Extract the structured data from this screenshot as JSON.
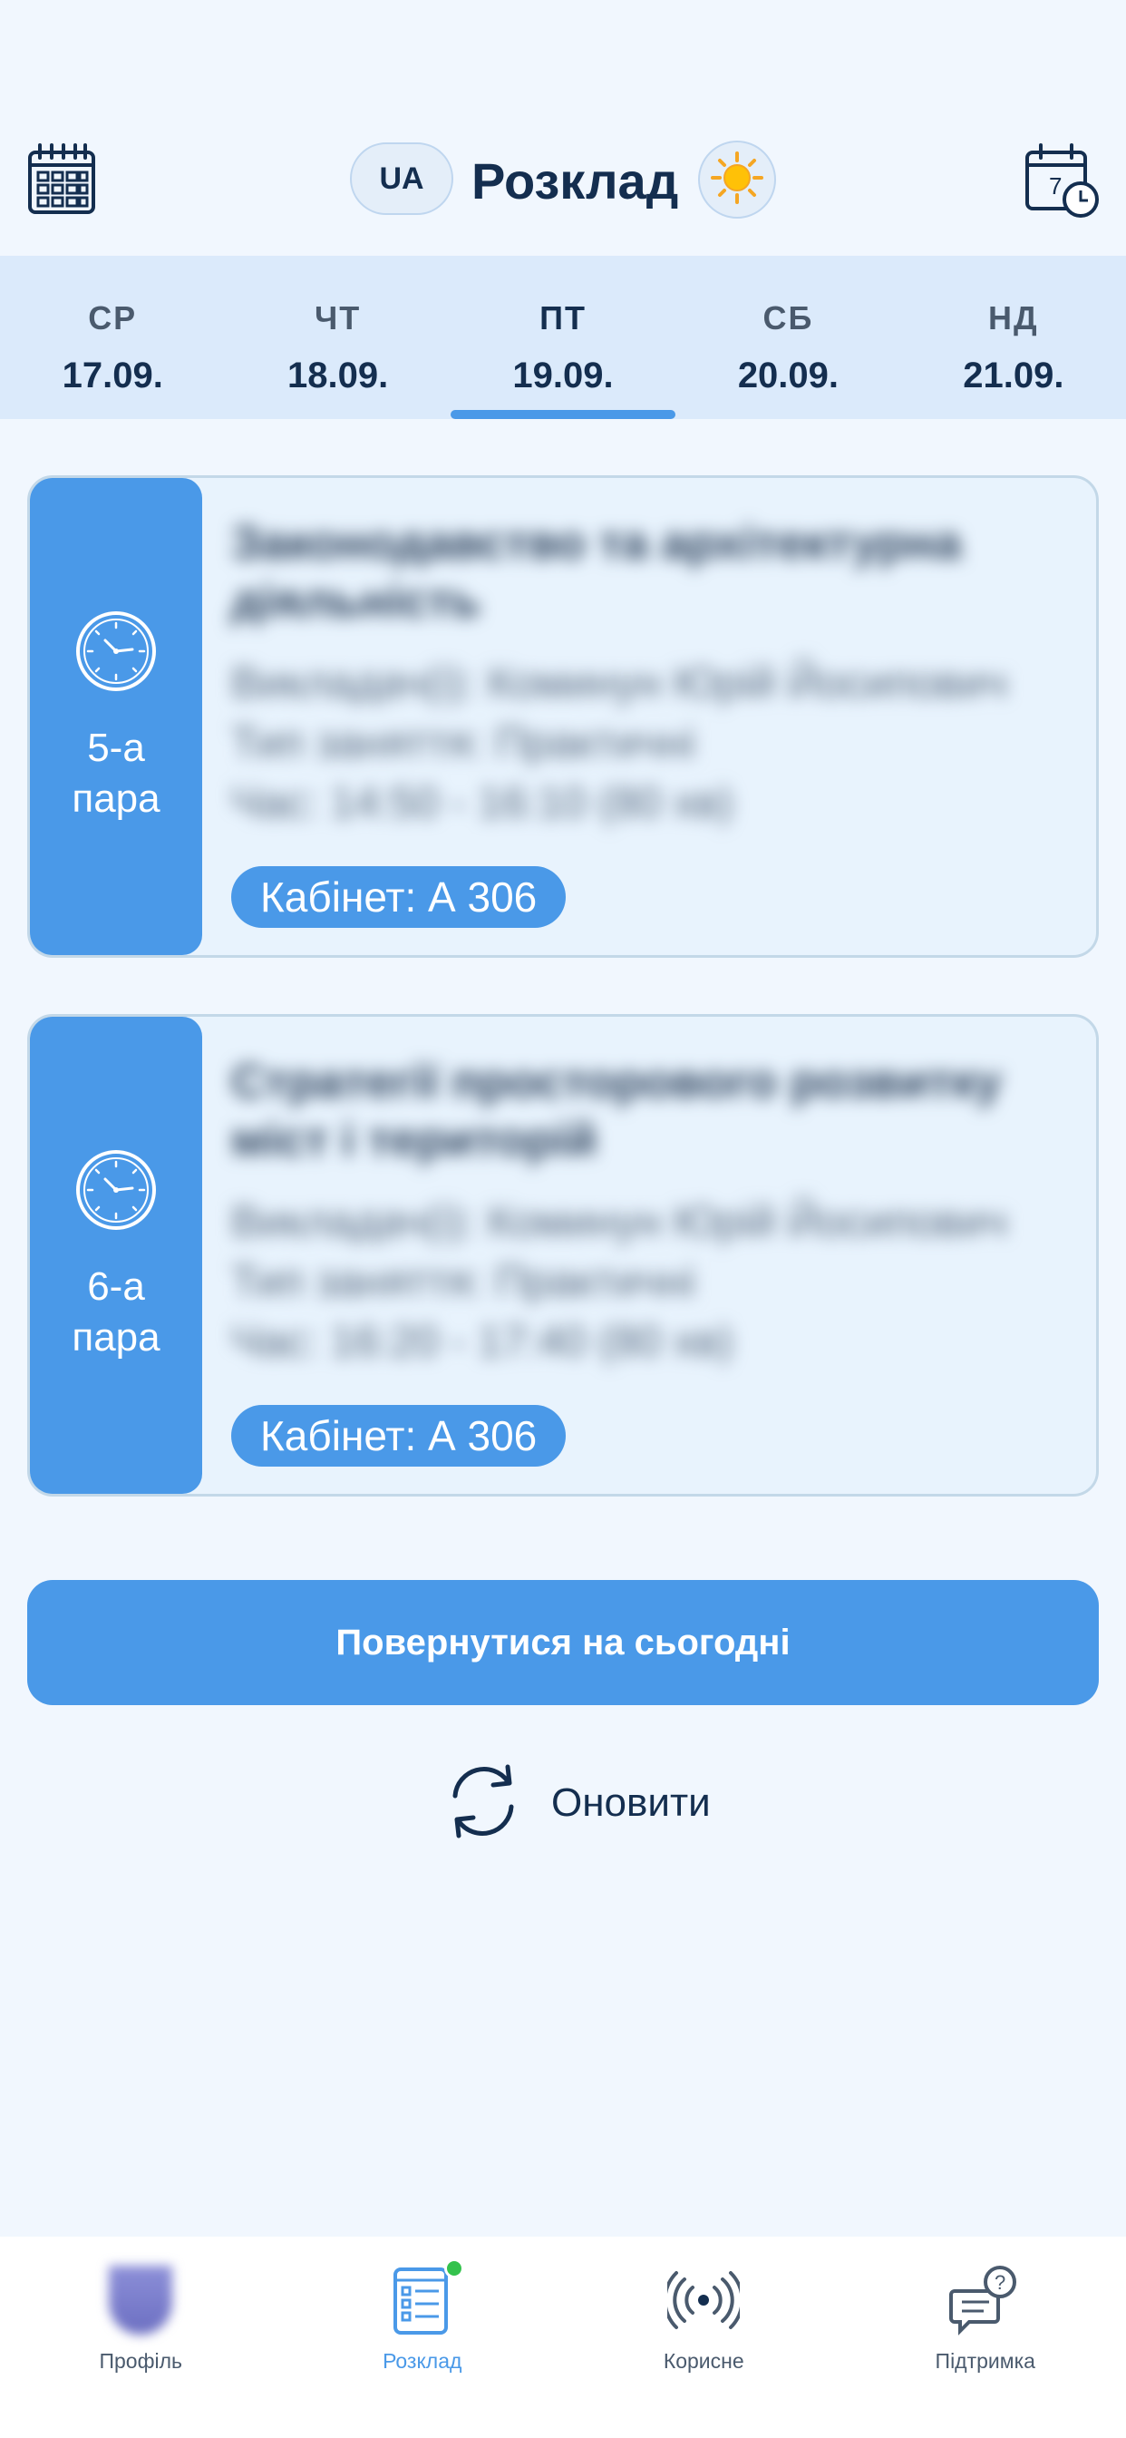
{
  "header": {
    "title": "Розклад",
    "language": "UA",
    "left_icon": "calendar-grid-icon",
    "right_icon": "calendar-clock-icon",
    "theme_icon": "sun-icon"
  },
  "days": [
    {
      "name": "СР",
      "date": "17.09.",
      "active": false
    },
    {
      "name": "ЧТ",
      "date": "18.09.",
      "active": false
    },
    {
      "name": "ПТ",
      "date": "19.09.",
      "active": true
    },
    {
      "name": "СБ",
      "date": "20.09.",
      "active": false
    },
    {
      "name": "НД",
      "date": "21.09.",
      "active": false
    }
  ],
  "lessons": [
    {
      "pair_number": "5-а",
      "pair_word": "пара",
      "subject": "Законодавство та архітектурна діяльність",
      "teacher": "Викладач(і): Коминун Юрій Йосипович",
      "type": "Тип заняття: Практичні",
      "time": "Час: 14:50 - 16:10 (80 хв)",
      "room": "Кабінет: А 306"
    },
    {
      "pair_number": "6-а",
      "pair_word": "пара",
      "subject": "Стратегії просторового розвитку міст і територій",
      "teacher": "Викладач(і): Коминун Юрій Йосипович",
      "type": "Тип заняття: Практичні",
      "time": "Час: 16:20 - 17:40 (80 хв)",
      "room": "Кабінет: А 306"
    }
  ],
  "actions": {
    "today_label": "Повернутися на сьогодні",
    "refresh_label": "Оновити"
  },
  "nav": {
    "profile": "Профіль",
    "schedule": "Розклад",
    "useful": "Корисне",
    "support": "Підтримка"
  },
  "colors": {
    "accent": "#4a99e8",
    "background": "#f1f7fe",
    "text_dark": "#142e4f",
    "badge_dot": "#34c24d"
  }
}
